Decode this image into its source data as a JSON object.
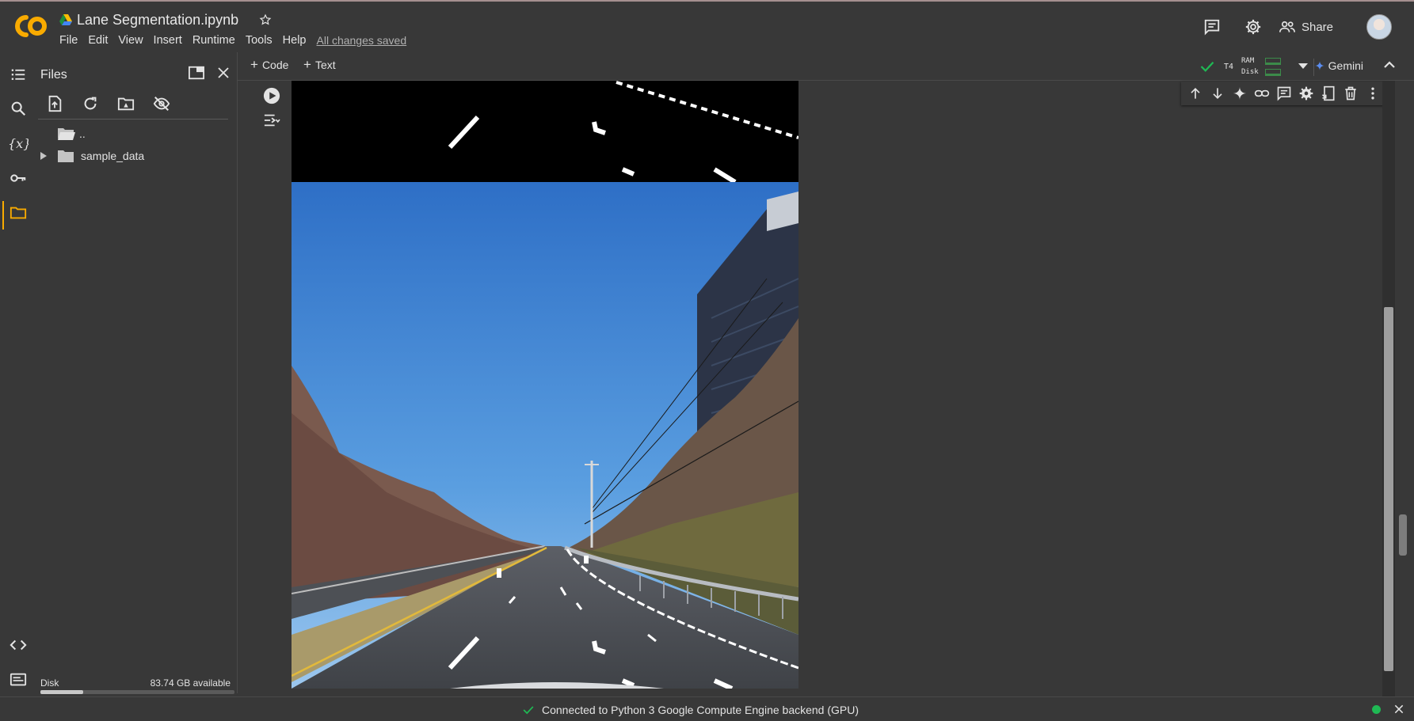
{
  "header": {
    "logo_text": "CO",
    "title": "Lane Segmentation.ipynb",
    "menu": [
      "File",
      "Edit",
      "View",
      "Insert",
      "Runtime",
      "Tools",
      "Help"
    ],
    "save_status": "All changes saved",
    "share_label": "Share"
  },
  "rail": {
    "icons": [
      "table-of-contents-icon",
      "search-icon",
      "variables-icon",
      "secrets-key-icon",
      "files-folder-icon",
      "code-snippets-icon",
      "terminal-icon"
    ],
    "active": "files-folder-icon"
  },
  "files_panel": {
    "title": "Files",
    "tree": [
      {
        "label": "..",
        "type": "parent-folder"
      },
      {
        "label": "sample_data",
        "type": "folder",
        "expanded": false
      }
    ],
    "disk_label": "Disk",
    "disk_available": "83.74 GB available",
    "disk_used_fraction": 0.22
  },
  "toolbar": {
    "add_code_label": "Code",
    "add_text_label": "Text",
    "gpu_label": "T4",
    "ram_label": "RAM",
    "disk_label": "Disk",
    "gemini_label": "Gemini"
  },
  "cell_toolbar": {
    "icons": [
      "move-up-icon",
      "move-down-icon",
      "gemini-sparkle-icon",
      "link-icon",
      "comment-icon",
      "settings-icon",
      "mirror-cell-icon",
      "delete-icon",
      "more-vert-icon"
    ]
  },
  "status_bar": {
    "message": "Connected to Python 3 Google Compute Engine backend (GPU)",
    "connected": true
  },
  "colors": {
    "background": "#383838",
    "logo_orange": "#f9ab00",
    "status_green": "#1fb954",
    "sky_blue": "#3f7fd0"
  }
}
